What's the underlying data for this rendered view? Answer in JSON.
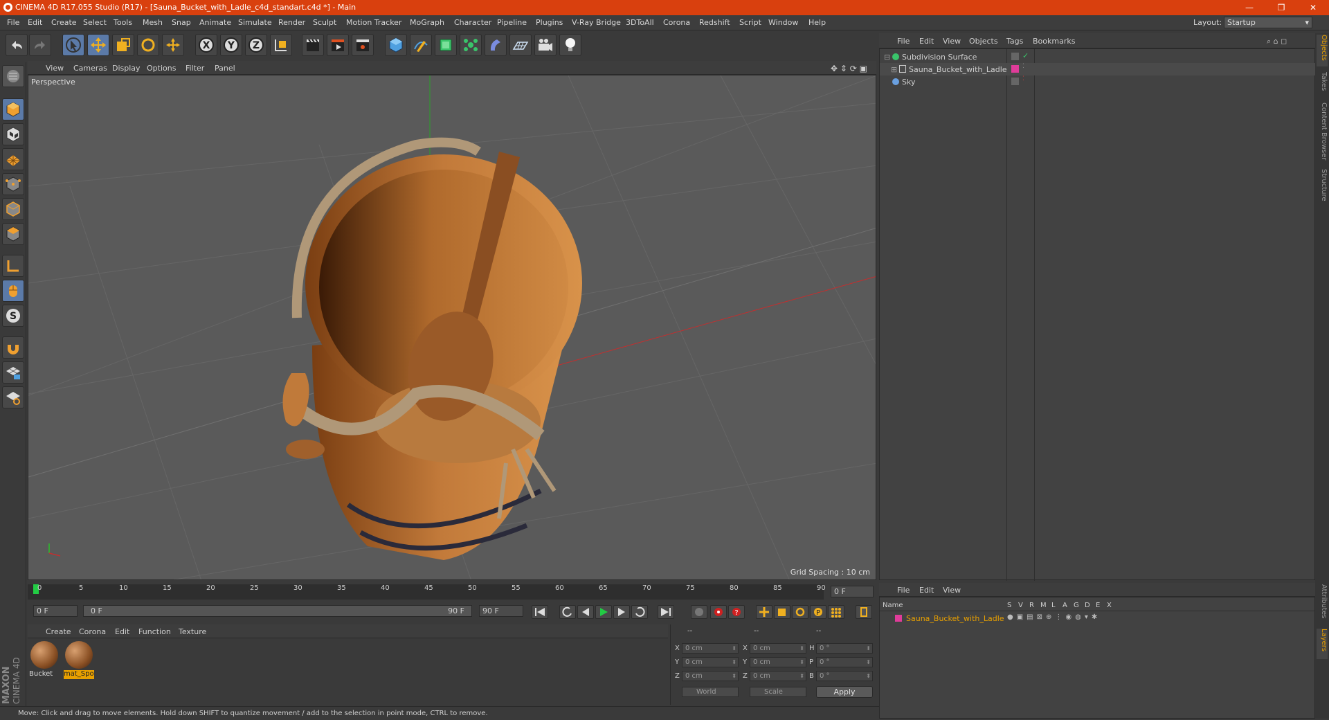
{
  "window": {
    "title": "CINEMA 4D R17.055 Studio (R17) - [Sauna_Bucket_with_Ladle_c4d_standart.c4d *] - Main",
    "minimize": "—",
    "restore": "❐",
    "close": "✕"
  },
  "menubar": {
    "items": [
      "File",
      "Edit",
      "Create",
      "Select",
      "Tools",
      "Mesh",
      "Snap",
      "Animate",
      "Simulate",
      "Render",
      "Sculpt",
      "Motion Tracker",
      "MoGraph",
      "Character",
      "Pipeline",
      "Plugins",
      "V-Ray Bridge",
      "3DToAll",
      "Corona",
      "Redshift",
      "Script",
      "Window",
      "Help"
    ],
    "layout_label": "Layout:",
    "layout_value": "Startup"
  },
  "viewport": {
    "menu": [
      "View",
      "Cameras",
      "Display",
      "Options",
      "Filter",
      "Panel"
    ],
    "label": "Perspective",
    "grid_spacing": "Grid Spacing : 10 cm"
  },
  "timeline": {
    "ticks": [
      "0",
      "5",
      "10",
      "15",
      "20",
      "25",
      "30",
      "35",
      "40",
      "45",
      "50",
      "55",
      "60",
      "65",
      "70",
      "75",
      "80",
      "85",
      "90"
    ],
    "current_frame": "0 F",
    "start_field": "0 F",
    "range_start": "0 F",
    "range_end": "90 F",
    "end_field": "90 F"
  },
  "materials": {
    "menu": [
      "Create",
      "Corona",
      "Edit",
      "Function",
      "Texture"
    ],
    "items": [
      {
        "name": "Bucket",
        "selected": false
      },
      {
        "name": "mat_Spo",
        "selected": true
      }
    ]
  },
  "coordinates": {
    "headers": [
      "--",
      "--",
      "--"
    ],
    "rows": [
      {
        "a": "X",
        "av": "0 cm",
        "b": "X",
        "bv": "0 cm",
        "c": "H",
        "cv": "0 °"
      },
      {
        "a": "Y",
        "av": "0 cm",
        "b": "Y",
        "bv": "0 cm",
        "c": "P",
        "cv": "0 °"
      },
      {
        "a": "Z",
        "av": "0 cm",
        "b": "Z",
        "bv": "0 cm",
        "c": "B",
        "cv": "0 °"
      }
    ],
    "world": "World",
    "scale": "Scale",
    "apply": "Apply"
  },
  "status": "Move: Click and drag to move elements. Hold down SHIFT to quantize movement / add to the selection in point mode, CTRL to remove.",
  "objects": {
    "menu": [
      "File",
      "Edit",
      "View",
      "Objects",
      "Tags",
      "Bookmarks"
    ],
    "rows": [
      {
        "name": "Subdivision Surface",
        "color": "#39c46a"
      },
      {
        "name": "Sauna_Bucket_with_Ladle",
        "color": "#e03c9a"
      },
      {
        "name": "Sky",
        "color": "#6aa0e0"
      }
    ]
  },
  "layers": {
    "menu": [
      "File",
      "Edit",
      "View"
    ],
    "headers": [
      "Name",
      "S",
      "V",
      "R",
      "M",
      "L",
      "A",
      "G",
      "D",
      "E",
      "X"
    ],
    "rows": [
      {
        "name": "Sauna_Bucket_with_Ladle",
        "color": "#e03c9a"
      }
    ]
  },
  "side_tabs": [
    "Objects",
    "Takes",
    "Content Browser",
    "Structure",
    "Attributes",
    "Layers"
  ],
  "brand": {
    "maxon": "MAXON",
    "c4d": "CINEMA 4D"
  }
}
